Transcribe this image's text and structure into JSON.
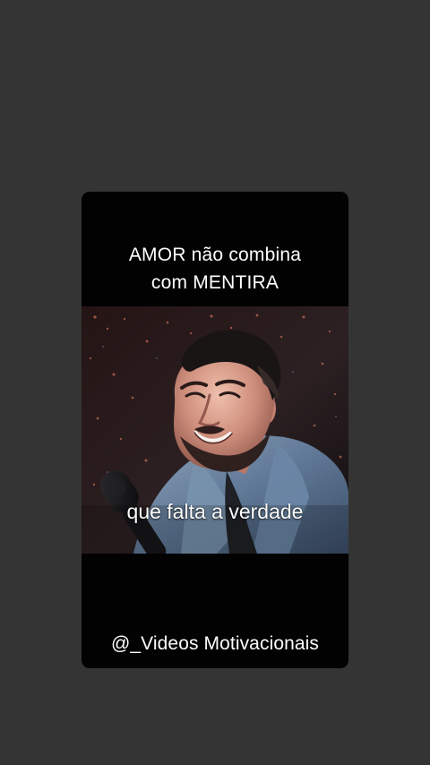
{
  "post": {
    "headline": "AMOR  não combina\ncom MENTIRA",
    "caption": "que falta a verdade",
    "watermark": "@_Videos Motivacionais"
  },
  "colors": {
    "background": "#343434",
    "card": "#020202",
    "text": "#ffffff"
  }
}
